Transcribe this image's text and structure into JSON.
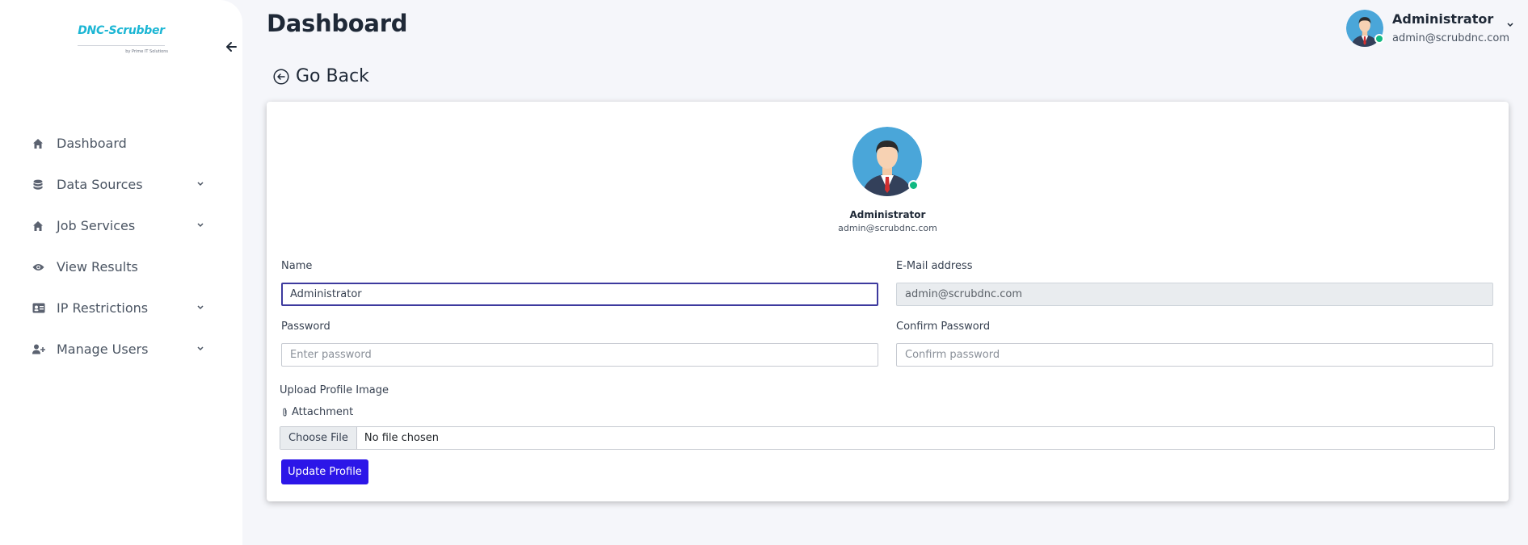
{
  "brand": {
    "name": "DNC-Scrubber",
    "tagline": "by Prime IT Solutions"
  },
  "sidebar": {
    "items": [
      {
        "label": "Dashboard",
        "icon": "home-icon",
        "expandable": false
      },
      {
        "label": "Data Sources",
        "icon": "database-icon",
        "expandable": true
      },
      {
        "label": "Job Services",
        "icon": "home-icon",
        "expandable": true
      },
      {
        "label": "View Results",
        "icon": "eye-icon",
        "expandable": false
      },
      {
        "label": "IP Restrictions",
        "icon": "id-card-icon",
        "expandable": true
      },
      {
        "label": "Manage Users",
        "icon": "user-plus-icon",
        "expandable": true
      }
    ]
  },
  "header": {
    "title": "Dashboard",
    "user": {
      "name": "Administrator",
      "email": "admin@scrubdnc.com",
      "status": "online"
    }
  },
  "go_back": {
    "label": "Go Back"
  },
  "profile": {
    "name": "Administrator",
    "email": "admin@scrubdnc.com"
  },
  "form": {
    "name": {
      "label": "Name",
      "value": "Administrator"
    },
    "email": {
      "label": "E-Mail address",
      "value": "admin@scrubdnc.com"
    },
    "password": {
      "label": "Password",
      "placeholder": "Enter password"
    },
    "confirm_password": {
      "label": "Confirm Password",
      "placeholder": "Confirm password"
    },
    "upload": {
      "label": "Upload Profile Image",
      "attachment_label": "Attachment",
      "choose_label": "Choose File",
      "status": "No file chosen"
    },
    "submit_label": "Update Profile"
  },
  "colors": {
    "brand": "#1cb6d4",
    "primary_button": "#2c16e8",
    "online": "#10b981",
    "focus_border": "#3d3a9e"
  }
}
